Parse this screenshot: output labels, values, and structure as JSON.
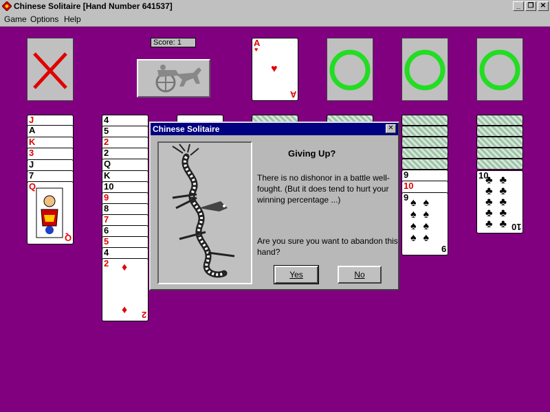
{
  "window": {
    "title": "Chinese Solitaire [Hand Number 641537]",
    "minimize": "_",
    "restore": "❐",
    "close": "✕"
  },
  "menu": {
    "items": [
      "Game",
      "Options",
      "Help"
    ]
  },
  "game": {
    "score_label": "Score: 1",
    "foundation_card": {
      "rank": "A",
      "suit": "♥"
    },
    "tableau": {
      "col1": [
        "J",
        "A",
        "K",
        "3",
        "J",
        "7",
        "Q"
      ],
      "col2": [
        "4",
        "5",
        "2",
        "2",
        "Q",
        "K",
        "10",
        "9",
        "8",
        "7",
        "6",
        "5",
        "4",
        "2"
      ],
      "col6": [
        "9",
        "10",
        "9"
      ],
      "col7": [
        "10"
      ]
    }
  },
  "dialog": {
    "title": "Chinese Solitaire",
    "close": "✕",
    "heading": "Giving Up?",
    "message": "There is no dishonor in a battle well-fought.  (But it does tend to hurt your winning percentage ...)",
    "question": "Are you sure you want to abandon this hand?",
    "yes_label": "Yes",
    "no_label": "No"
  },
  "colors": {
    "background": "#800080",
    "x_mark": "#e00000",
    "circle_mark": "#22dd22",
    "card_back": "#9fc4a8"
  }
}
